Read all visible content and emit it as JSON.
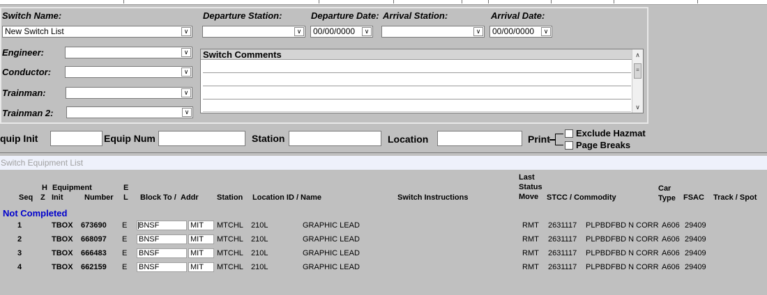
{
  "top_form": {
    "switch_name": {
      "label": "Switch Name:",
      "value": "New Switch List"
    },
    "departure_station": {
      "label": "Departure Station:",
      "value": ""
    },
    "departure_date": {
      "label": "Departure Date:",
      "value": "00/00/0000"
    },
    "arrival_station": {
      "label": "Arrival Station:",
      "value": ""
    },
    "arrival_date": {
      "label": "Arrival Date:",
      "value": "00/00/0000"
    },
    "engineer": {
      "label": "Engineer:",
      "value": ""
    },
    "conductor": {
      "label": "Conductor:",
      "value": ""
    },
    "trainman": {
      "label": "Trainman:",
      "value": ""
    },
    "trainman2": {
      "label": "Trainman 2:",
      "value": ""
    },
    "comments": {
      "label": "Switch Comments"
    }
  },
  "filter_bar": {
    "equip_init_label": "quip Init",
    "equip_num_label": "Equip Num",
    "station_label": "Station",
    "location_label": "Location",
    "print_label": "Print",
    "exclude_hazmat_label": "Exclude Hazmat",
    "page_breaks_label": "Page Breaks"
  },
  "section_title": "Switch Equipment List",
  "columns": {
    "seq": "Seq",
    "hz_top": "H",
    "hz_bottom": "Z",
    "equipment": "Equipment",
    "init": "Init",
    "number": "Number",
    "el_top": "E",
    "el_bottom": "L",
    "block_to": "Block To /",
    "addr": "Addr",
    "station": "Station",
    "location": "Location ID / Name",
    "instructions": "Switch Instructions",
    "last": "Last",
    "status": "Status",
    "move": "Move",
    "stcc": "STCC / Commodity",
    "car": "Car",
    "type": "Type",
    "fsac": "FSAC",
    "track": "Track / Spot"
  },
  "group_label": "Not Completed",
  "rows": [
    {
      "seq": "1",
      "init": "TBOX",
      "number": "673690",
      "el": "E",
      "block": "BNSF",
      "addr": "MIT",
      "station": "MTCHL",
      "loc_id": "210L",
      "loc_name": "GRAPHIC LEAD",
      "move": "RMT",
      "stcc": "2631117",
      "commodity": "PLPBDFBD N CORR",
      "car_type": "A606",
      "fsac": "29409"
    },
    {
      "seq": "2",
      "init": "TBOX",
      "number": "668097",
      "el": "E",
      "block": "BNSF",
      "addr": "MIT",
      "station": "MTCHL",
      "loc_id": "210L",
      "loc_name": "GRAPHIC LEAD",
      "move": "RMT",
      "stcc": "2631117",
      "commodity": "PLPBDFBD N CORR",
      "car_type": "A606",
      "fsac": "29409"
    },
    {
      "seq": "3",
      "init": "TBOX",
      "number": "666483",
      "el": "E",
      "block": "BNSF",
      "addr": "MIT",
      "station": "MTCHL",
      "loc_id": "210L",
      "loc_name": "GRAPHIC LEAD",
      "move": "RMT",
      "stcc": "2631117",
      "commodity": "PLPBDFBD N CORR",
      "car_type": "A606",
      "fsac": "29409"
    },
    {
      "seq": "4",
      "init": "TBOX",
      "number": "662159",
      "el": "E",
      "block": "BNSF",
      "addr": "MIT",
      "station": "MTCHL",
      "loc_id": "210L",
      "loc_name": "GRAPHIC LEAD",
      "move": "RMT",
      "stcc": "2631117",
      "commodity": "PLPBDFBD N CORR",
      "car_type": "A606",
      "fsac": "29409"
    }
  ]
}
